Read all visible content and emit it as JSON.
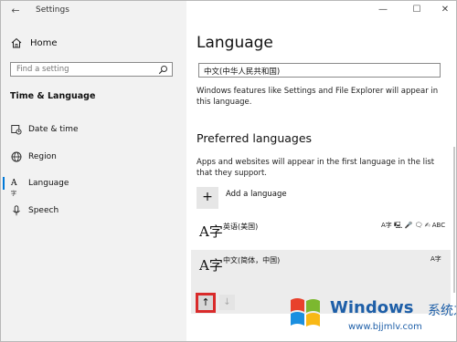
{
  "window": {
    "title": "Settings"
  },
  "controls": {
    "minimize": "—",
    "maximize": "☐",
    "close": "✕",
    "back": "←"
  },
  "sidebar": {
    "home": "Home",
    "search_placeholder": "Find a setting",
    "section": "Time & Language",
    "items": [
      {
        "label": "Date & time",
        "icon": "calendar-clock-icon"
      },
      {
        "label": "Region",
        "icon": "globe-icon"
      },
      {
        "label": "Language",
        "icon": "language-icon",
        "active": true
      },
      {
        "label": "Speech",
        "icon": "microphone-icon"
      }
    ]
  },
  "main": {
    "title": "Language",
    "display_language": "中文(中华人民共和国)",
    "display_desc": "Windows features like Settings and File Explorer will appear in this language.",
    "preferred_title": "Preferred languages",
    "preferred_desc": "Apps and websites will appear in the first language in the list that they support.",
    "add_label": "Add a language",
    "add_symbol": "+",
    "glyph": "A字",
    "languages": [
      {
        "name": "英语(美国)",
        "features": "A字 🖳 🎤 🗨 ✍ ABC"
      },
      {
        "name": "中文(简体，中国)",
        "features": "A字"
      }
    ],
    "up_arrow": "↑",
    "down_arrow": "↓"
  },
  "watermark": {
    "brand": "Windows",
    "cn": "系统之家",
    "url": "www.bjjmlv.com",
    "colors": {
      "text": "#1e5fa8",
      "red": "#e8412c",
      "green": "#7cb82f",
      "blue": "#1a8fe0",
      "yellow": "#f8b816"
    }
  },
  "colors": {
    "accent": "#0078d7",
    "highlight": "#d92b2b"
  }
}
